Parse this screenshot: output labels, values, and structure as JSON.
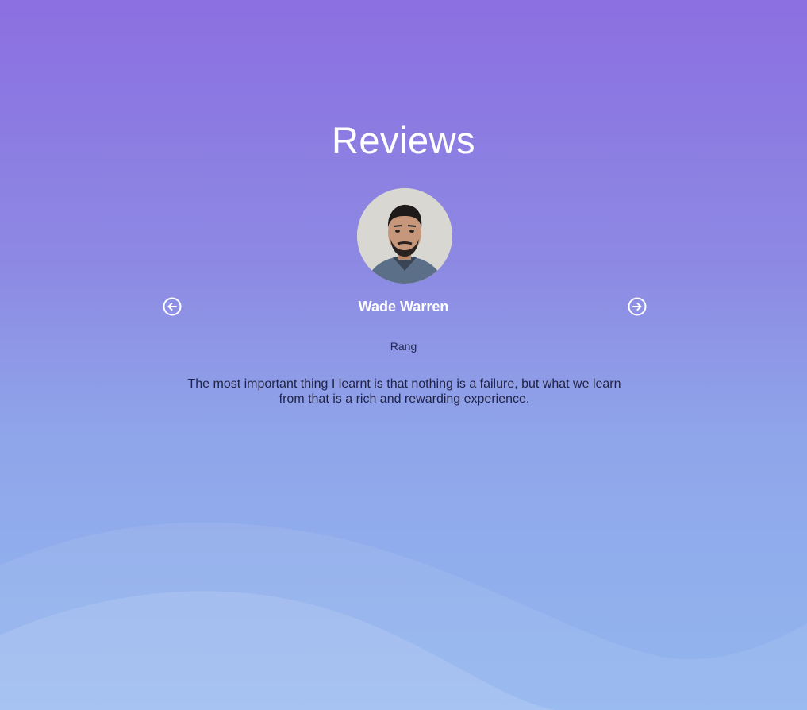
{
  "section": {
    "title": "Reviews"
  },
  "review": {
    "name": "Wade Warren",
    "role": "Rang",
    "text": "The most important thing I learnt is that nothing is a failure, but what we learn from that is a rich and rewarding experience."
  },
  "nav": {
    "prev_icon": "arrow-left-circle-icon",
    "next_icon": "arrow-right-circle-icon"
  },
  "colors": {
    "gradient_top": "#8c6fe1",
    "gradient_bottom": "#92b6ee",
    "title": "#ffffff",
    "body_text": "#1f2244"
  }
}
